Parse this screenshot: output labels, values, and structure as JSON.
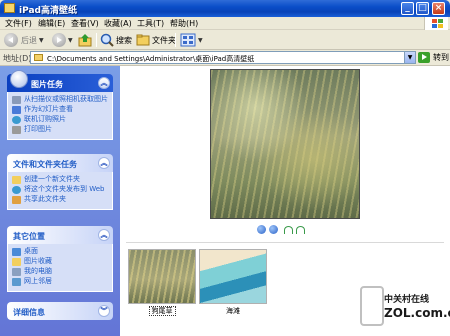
{
  "window": {
    "title": "iPad高清壁纸"
  },
  "menu": [
    "文件(F)",
    "编辑(E)",
    "查看(V)",
    "收藏(A)",
    "工具(T)",
    "帮助(H)"
  ],
  "toolbar": {
    "back": "后退",
    "search": "搜索",
    "folders": "文件夹"
  },
  "address": {
    "label": "地址(D)",
    "path": "C:\\Documents and Settings\\Administrator\\桌面\\iPad高清壁纸",
    "go": "转到"
  },
  "sidebar": {
    "picture_tasks": {
      "title": "图片任务",
      "items": [
        "从扫描仪或照相机获取图片",
        "作为幻灯片查看",
        "联机订购照片",
        "打印图片"
      ]
    },
    "file_tasks": {
      "title": "文件和文件夹任务",
      "items": [
        "创建一个新文件夹",
        "将这个文件夹发布到 Web",
        "共享此文件夹"
      ]
    },
    "other_places": {
      "title": "其它位置",
      "items": [
        "桌面",
        "图片收藏",
        "我的电脑",
        "网上邻居"
      ]
    },
    "details": {
      "title": "详细信息"
    }
  },
  "thumbnails": [
    {
      "name": "狗尾草",
      "selected": true
    },
    {
      "name": "海滩",
      "selected": false
    }
  ],
  "watermark": {
    "text": "中关村在线",
    "url": "ZOL.com.cn"
  }
}
